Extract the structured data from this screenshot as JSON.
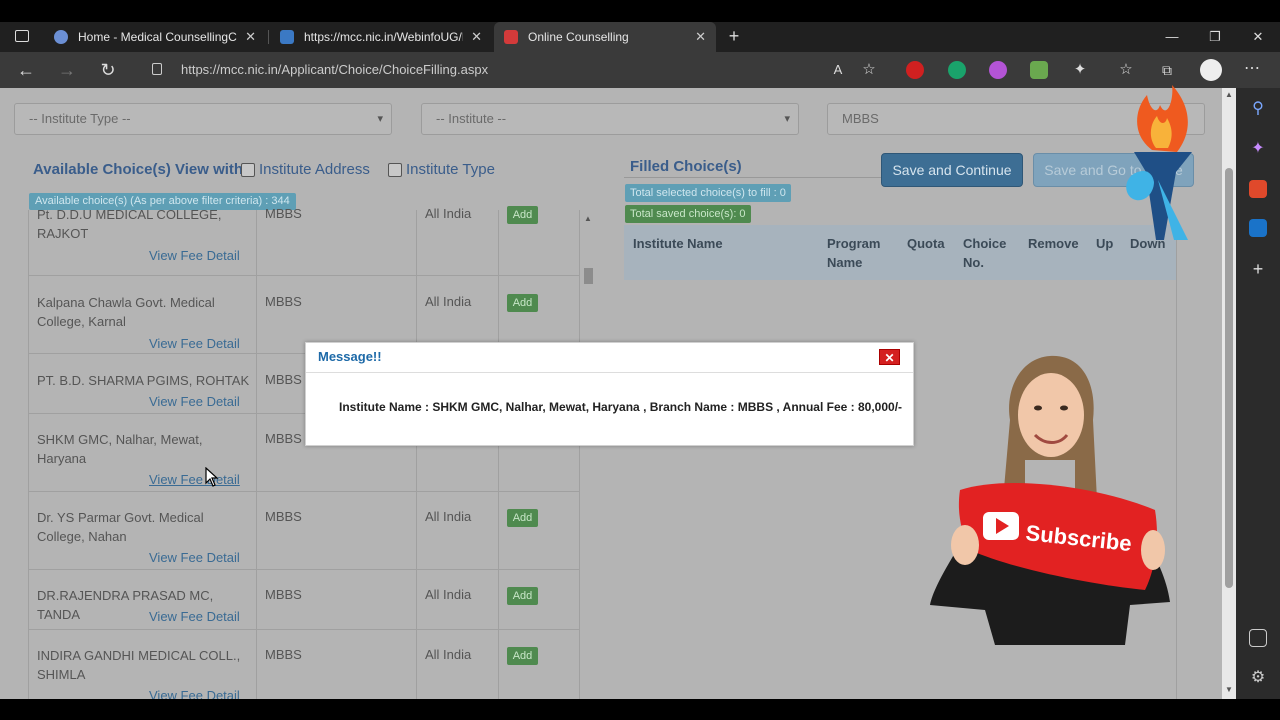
{
  "browser": {
    "tabs": [
      {
        "title": "Home - Medical CounsellingCom",
        "icon_color": "#6b8fd4"
      },
      {
        "title": "https://mcc.nic.in/WebinfoUG/Pa",
        "icon_color": "#3b79c4"
      },
      {
        "title": "Online Counselling",
        "icon_color": "#d33a3a"
      }
    ],
    "url": "https://mcc.nic.in/Applicant/Choice/ChoiceFilling.aspx",
    "new_tab_glyph": "+",
    "close_glyph": "✕"
  },
  "filters": {
    "institute_type": "-- Institute Type --",
    "institute": "-- Institute --",
    "course": "MBBS"
  },
  "available": {
    "header": "Available Choice(s) View with :",
    "opt_address": "Institute Address",
    "opt_type": "Institute Type",
    "count_badge": "Available choice(s) (As per above filter criteria) : 344",
    "fee_link": "View Fee Detail",
    "add_label": "Add",
    "rows": [
      {
        "name": "Pt. D.D.U MEDICAL COLLEGE, RAJKOT",
        "program": "MBBS",
        "quota": "All India"
      },
      {
        "name": "Kalpana Chawla Govt. Medical College, Karnal",
        "program": "MBBS",
        "quota": "All India"
      },
      {
        "name": "PT. B.D. SHARMA PGIMS, ROHTAK",
        "program": "MBBS",
        "quota": ""
      },
      {
        "name": "SHKM GMC, Nalhar, Mewat, Haryana",
        "program": "MBBS",
        "quota": ""
      },
      {
        "name": "Dr. YS Parmar Govt. Medical College, Nahan",
        "program": "MBBS",
        "quota": "All India"
      },
      {
        "name": "DR.RAJENDRA PRASAD MC, TANDA",
        "program": "MBBS",
        "quota": "All India"
      },
      {
        "name": "INDIRA GANDHI MEDICAL COLL., SHIMLA",
        "program": "MBBS",
        "quota": "All India"
      }
    ]
  },
  "filled": {
    "header": "Filled Choice(s)",
    "selected_badge": "Total selected choice(s) to fill : 0",
    "saved_badge": "Total saved choice(s): 0",
    "save_continue": "Save and Continue",
    "save_go": "Save and Go to Home",
    "columns": [
      "Institute Name",
      "Program Name",
      "Quota",
      "Choice No.",
      "Remove",
      "Up",
      "Down"
    ]
  },
  "dialog": {
    "title": "Message!!",
    "close": "✕",
    "message": "Institute Name : SHKM GMC, Nalhar, Mewat, Haryana , Branch Name : MBBS , Annual Fee : 80,000/-"
  },
  "overlay": {
    "subscribe_text": "Subscribe"
  }
}
